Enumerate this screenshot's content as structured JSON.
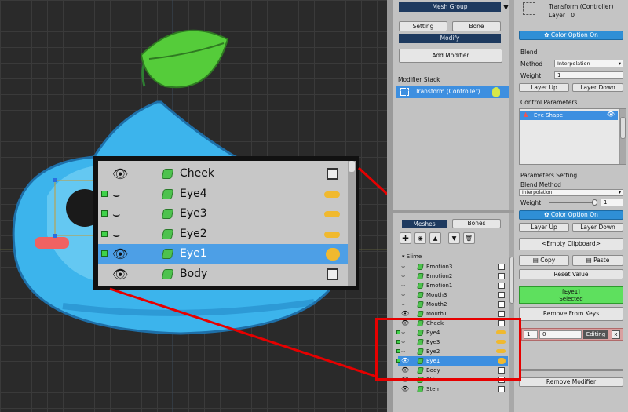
{
  "viewport": {
    "label": ""
  },
  "modifier_panel": {
    "mesh_group_label": "Mesh Group",
    "setting_label": "Setting",
    "bone_label": "Bone",
    "modify_label": "Modify",
    "add_modifier_label": "Add Modifier",
    "modifier_stack_label": "Modifier Stack",
    "stack_item": "Transform (Controller)"
  },
  "hierarchy": {
    "tab_meshes": "Meshes",
    "tab_bones": "Bones",
    "root": "Slime",
    "rows": [
      {
        "name": "Emotion3",
        "vis": "line",
        "green": false,
        "kind": "cb"
      },
      {
        "name": "Emotion2",
        "vis": "line",
        "green": false,
        "kind": "cb"
      },
      {
        "name": "Emotion1",
        "vis": "line",
        "green": false,
        "kind": "cb"
      },
      {
        "name": "Mouth3",
        "vis": "line",
        "green": false,
        "kind": "cb"
      },
      {
        "name": "Mouth2",
        "vis": "line",
        "green": false,
        "kind": "cb"
      },
      {
        "name": "Mouth1",
        "vis": "eye",
        "green": false,
        "kind": "cb"
      },
      {
        "name": "Cheek",
        "vis": "eye",
        "green": false,
        "kind": "cb"
      },
      {
        "name": "Eye4",
        "vis": "line",
        "green": true,
        "kind": "kf"
      },
      {
        "name": "Eye3",
        "vis": "line",
        "green": true,
        "kind": "kf"
      },
      {
        "name": "Eye2",
        "vis": "line",
        "green": true,
        "kind": "kf"
      },
      {
        "name": "Eye1",
        "vis": "eye",
        "green": true,
        "kind": "kfsel",
        "selected": true
      },
      {
        "name": "Body",
        "vis": "eye",
        "green": false,
        "kind": "cb"
      },
      {
        "name": "Shin",
        "vis": "eye",
        "green": false,
        "kind": "cb"
      },
      {
        "name": "Stem",
        "vis": "eye",
        "green": false,
        "kind": "cb"
      }
    ]
  },
  "inspector": {
    "title": "Transform (Controller)",
    "layer": "Layer : 0",
    "color_option": "Color Option On",
    "blend_label": "Blend",
    "method_label": "Method",
    "method_value": "Interpolation",
    "weight_label": "Weight",
    "weight_value": "1",
    "layer_up": "Layer Up",
    "layer_down": "Layer Down",
    "control_params_label": "Control Parameters",
    "param_item": "Eye Shape",
    "params_setting_label": "Parameters Setting",
    "blend_method_label": "Blend Method",
    "blend_method_value": "Interpolation",
    "weight2_label": "Weight",
    "weight2_value": "1",
    "color_option2": "Color Option On",
    "layer_up2": "Layer Up",
    "layer_down2": "Layer Down",
    "clipboard": "<Empty Clipboard>",
    "copy": "Copy",
    "paste": "Paste",
    "reset_value": "Reset Value",
    "selected_name": "[Eye1]",
    "selected_state": "Selected",
    "remove_from_keys": "Remove From Keys",
    "key_field1": "1",
    "key_field2": "0",
    "editing": "Editing",
    "close": "x",
    "remove_modifier": "Remove Modifier"
  },
  "zoom": {
    "rows": [
      {
        "name": "Cheek",
        "vis": "eye",
        "green": false,
        "kind": "cb"
      },
      {
        "name": "Eye4",
        "vis": "line",
        "green": true,
        "kind": "kf"
      },
      {
        "name": "Eye3",
        "vis": "line",
        "green": true,
        "kind": "kf"
      },
      {
        "name": "Eye2",
        "vis": "line",
        "green": true,
        "kind": "kf"
      },
      {
        "name": "Eye1",
        "vis": "eye",
        "green": true,
        "kind": "kfsel",
        "selected": true
      },
      {
        "name": "Body",
        "vis": "eye",
        "green": false,
        "kind": "cb"
      }
    ]
  },
  "colors": {
    "accent_blue": "#2f8fd6",
    "highlight_red": "#e60000",
    "selected_green": "#5ee05e"
  }
}
